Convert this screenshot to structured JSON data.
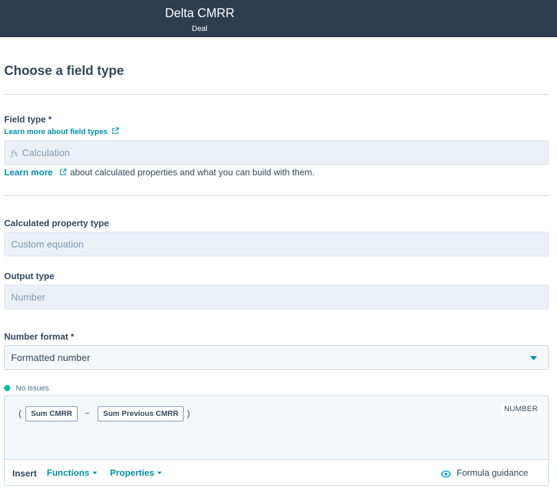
{
  "header": {
    "title": "Delta CMRR",
    "subtitle": "Deal"
  },
  "page": {
    "heading": "Choose a field type"
  },
  "field_type": {
    "label": "Field type *",
    "learn_link": "Learn more about field types",
    "icon": "function-icon",
    "value": "Calculation",
    "helper_link": "Learn more",
    "helper_text": "about calculated properties and what you can build with them."
  },
  "calculated_type": {
    "label": "Calculated property type",
    "value": "Custom equation"
  },
  "output_type": {
    "label": "Output type",
    "value": "Number"
  },
  "number_format": {
    "label": "Number format *",
    "value": "Formatted number"
  },
  "validation": {
    "status": "No issues",
    "color": "#00bda5"
  },
  "formula": {
    "open_paren": "(",
    "token1": "Sum CMRR",
    "operator": "−",
    "token2": "Sum Previous CMRR",
    "close_paren": ")",
    "output_badge": "NUMBER"
  },
  "toolbar": {
    "insert": "Insert",
    "functions": "Functions",
    "properties": "Properties",
    "guidance": "Formula guidance"
  },
  "colors": {
    "header_bg": "#2d3e50",
    "accent": "#0091ae",
    "field_bg": "#eaf0f6"
  }
}
